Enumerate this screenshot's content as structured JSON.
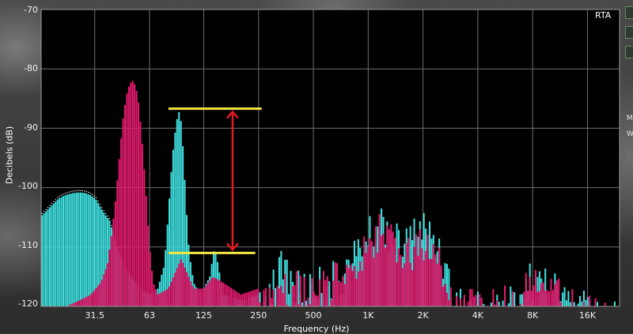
{
  "chart_data": {
    "type": "bar",
    "title": "",
    "corner_label": "RTA",
    "xlabel": "Frequency (Hz)",
    "ylabel": "Decibels (dB)",
    "xscale": "log",
    "xlim": [
      16,
      24000
    ],
    "ylim": [
      -120,
      -70
    ],
    "grid": true,
    "y_ticks": [
      -70,
      -80,
      -90,
      -100,
      -110,
      -120
    ],
    "y_tick_labels": [
      "-70",
      "-80",
      "-90",
      "-100",
      "-110",
      "-120"
    ],
    "x_ticks": [
      31.5,
      63,
      125,
      250,
      500,
      1000,
      2000,
      4000,
      8000,
      16000
    ],
    "x_tick_labels": [
      "31.5",
      "63",
      "125",
      "250",
      "500",
      "1K",
      "2K",
      "4K",
      "8K",
      "16K"
    ],
    "series": [
      {
        "color": "#40e0e0",
        "points": [
          [
            16,
            -104.8
          ],
          [
            17,
            -104.0
          ],
          [
            18,
            -103.2
          ],
          [
            19,
            -102.5
          ],
          [
            20,
            -101.8
          ],
          [
            22,
            -101.2
          ],
          [
            24,
            -100.9
          ],
          [
            26,
            -100.8
          ],
          [
            28,
            -100.9
          ],
          [
            30,
            -101.3
          ],
          [
            32,
            -102.0
          ],
          [
            34,
            -103.4
          ],
          [
            36,
            -104.6
          ],
          [
            38,
            -105.5
          ],
          [
            40,
            -108.0
          ],
          [
            43,
            -111.0
          ],
          [
            46,
            -113.0
          ],
          [
            50,
            -115.0
          ],
          [
            56,
            -117.0
          ],
          [
            63,
            -118.0
          ],
          [
            70,
            -117.0
          ],
          [
            76,
            -113.0
          ],
          [
            80,
            -104.0
          ],
          [
            84,
            -95.0
          ],
          [
            88,
            -89.5
          ],
          [
            91,
            -87.0
          ],
          [
            94,
            -89.0
          ],
          [
            97,
            -95.0
          ],
          [
            100,
            -103.0
          ],
          [
            104,
            -111.0
          ],
          [
            110,
            -116.0
          ],
          [
            120,
            -118.0
          ],
          [
            135,
            -115.0
          ],
          [
            143,
            -110.0
          ],
          [
            150,
            -113.0
          ],
          [
            160,
            -118.0
          ],
          [
            200,
            -119.0
          ],
          [
            250,
            -118.0
          ],
          [
            300,
            -112.0
          ],
          [
            350,
            -110.0
          ],
          [
            400,
            -114.0
          ],
          [
            500,
            -113.0
          ],
          [
            700,
            -112.0
          ],
          [
            1000,
            -105.0
          ],
          [
            1200,
            -102.0
          ],
          [
            1500,
            -107.0
          ],
          [
            2000,
            -103.0
          ],
          [
            2500,
            -107.0
          ],
          [
            3000,
            -116.0
          ],
          [
            4000,
            -117.0
          ],
          [
            6000,
            -116.0
          ],
          [
            8000,
            -112.0
          ],
          [
            10000,
            -114.0
          ],
          [
            12000,
            -115.0
          ],
          [
            14000,
            -116.5
          ],
          [
            16000,
            -116.5
          ],
          [
            20000,
            -118.5
          ],
          [
            24000,
            -119.2
          ]
        ]
      },
      {
        "color": "#e01a6c",
        "points": [
          [
            22,
            -120.0
          ],
          [
            26,
            -119.0
          ],
          [
            30,
            -118.0
          ],
          [
            34,
            -116.0
          ],
          [
            37,
            -113.0
          ],
          [
            39,
            -108.0
          ],
          [
            41,
            -102.0
          ],
          [
            43,
            -95.0
          ],
          [
            45,
            -88.5
          ],
          [
            47,
            -84.5
          ],
          [
            49,
            -82.5
          ],
          [
            51,
            -82.0
          ],
          [
            53,
            -83.0
          ],
          [
            55,
            -86.0
          ],
          [
            57,
            -91.0
          ],
          [
            60,
            -100.0
          ],
          [
            63,
            -110.0
          ],
          [
            66,
            -116.0
          ],
          [
            70,
            -118.0
          ],
          [
            80,
            -117.0
          ],
          [
            88,
            -114.0
          ],
          [
            94,
            -112.0
          ],
          [
            100,
            -114.0
          ],
          [
            110,
            -117.0
          ],
          [
            125,
            -117.0
          ],
          [
            140,
            -115.0
          ],
          [
            160,
            -116.0
          ],
          [
            200,
            -118.0
          ],
          [
            250,
            -117.0
          ],
          [
            300,
            -115.0
          ],
          [
            400,
            -114.0
          ],
          [
            500,
            -115.0
          ],
          [
            700,
            -112.0
          ],
          [
            1000,
            -106.0
          ],
          [
            1200,
            -104.0
          ],
          [
            1500,
            -108.0
          ],
          [
            2000,
            -106.0
          ],
          [
            2500,
            -109.0
          ],
          [
            3000,
            -117.0
          ],
          [
            4000,
            -117.0
          ],
          [
            6000,
            -116.0
          ],
          [
            7000,
            -114.0
          ],
          [
            8000,
            -111.0
          ],
          [
            9000,
            -112.0
          ],
          [
            10000,
            -114.0
          ],
          [
            12000,
            -116.0
          ],
          [
            16000,
            -117.0
          ],
          [
            20000,
            -118.5
          ],
          [
            24000,
            -120.0
          ]
        ]
      }
    ],
    "annotations": {
      "line_color": "#f4e842",
      "arrow_color": "#e31b23",
      "upper_level_db": -86.7,
      "lower_level_db": -111.0,
      "upper_line_hz": [
        80,
        260
      ],
      "lower_line_hz": [
        80,
        240
      ],
      "arrow_hz": 180
    }
  },
  "side_panel": {
    "letters": [
      "M",
      "W"
    ]
  }
}
